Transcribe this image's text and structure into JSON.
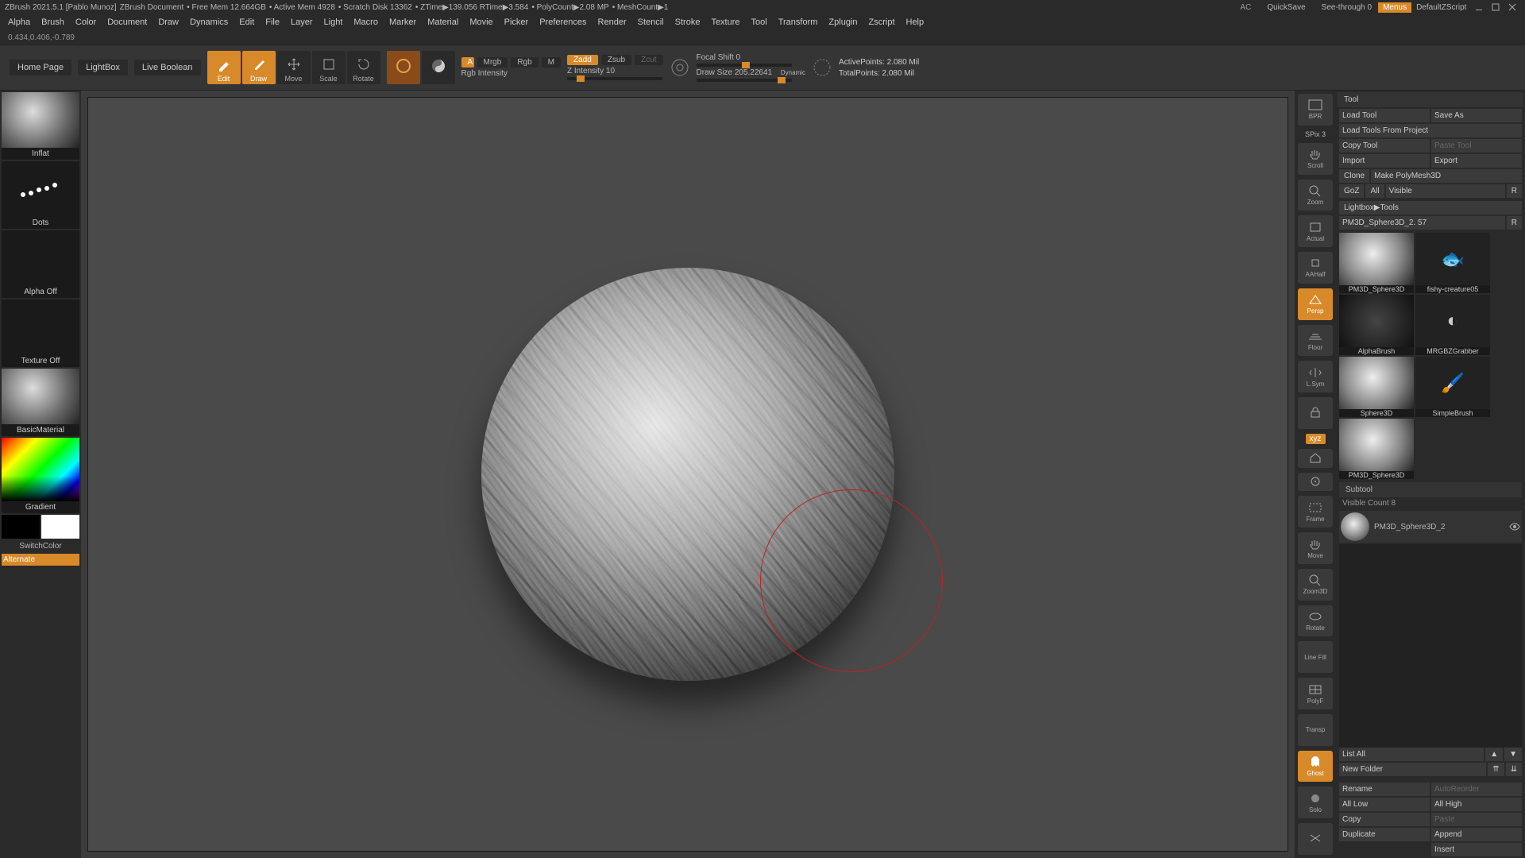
{
  "titlebar": {
    "app": "ZBrush 2021.5.1 [Pablo Munoz]",
    "doc": "ZBrush Document",
    "metrics": [
      "• Free Mem 12.664GB",
      "• Active Mem 4928",
      "• Scratch Disk 13362",
      "• ZTime▶139.056 RTime▶3.584",
      "• PolyCount▶2.08 MP",
      "• MeshCount▶1"
    ],
    "ac": "AC",
    "quicksave": "QuickSave",
    "seethrough": "See-through  0",
    "menus": "Menus",
    "zscript": "DefaultZScript"
  },
  "menu": [
    "Alpha",
    "Brush",
    "Color",
    "Document",
    "Draw",
    "Dynamics",
    "Edit",
    "File",
    "Layer",
    "Light",
    "Macro",
    "Marker",
    "Material",
    "Movie",
    "Picker",
    "Preferences",
    "Render",
    "Stencil",
    "Stroke",
    "Texture",
    "Tool",
    "Transform",
    "Zplugin",
    "Zscript",
    "Help"
  ],
  "coords": "0.434,0.406,-0.789",
  "toolbar": {
    "home": "Home Page",
    "lightbox": "LightBox",
    "liveboolean": "Live Boolean",
    "edit": "Edit",
    "draw": "Draw",
    "move": "Move",
    "scale": "Scale",
    "rotate": "Rotate",
    "a": "A",
    "mrgb": "Mrgb",
    "rgb": "Rgb",
    "m": "M",
    "rgb_intensity": "Rgb Intensity",
    "zadd": "Zadd",
    "zsub": "Zsub",
    "zcut": "Zcut",
    "zintensity": "Z Intensity 10",
    "focal": "Focal Shift 0",
    "drawsize": "Draw Size 205.22641",
    "dynamic": "Dynamic",
    "active": "ActivePoints: 2.080 Mil",
    "total": "TotalPoints: 2.080 Mil"
  },
  "left": {
    "brush": "Inflat",
    "stroke": "Dots",
    "alpha": "Alpha Off",
    "texture": "Texture Off",
    "material": "BasicMaterial",
    "gradient": "Gradient",
    "switch": "SwitchColor",
    "alternate": "Alternate"
  },
  "rightstrip": {
    "bpr": "BPR",
    "spix": "SPix 3",
    "scroll": "Scroll",
    "zoom": "Zoom",
    "actual": "Actual",
    "aahalf": "AAHalf",
    "persp": "Persp",
    "floor": "Floor",
    "lsym": "L.Sym",
    "lock": "",
    "xyz": "xyz",
    "frame": "Frame",
    "move": "Move",
    "zoom3d": "Zoom3D",
    "rotate": "Rotate",
    "linefill": "Line Fill",
    "polyf": "PolyF",
    "transp": "Transp",
    "ghost": "Ghost",
    "solo": "Solo",
    "xpolish": ""
  },
  "tool": {
    "title": "Tool",
    "loadtool": "Load Tool",
    "saveas": "Save As",
    "loadproj": "Load Tools From Project",
    "copytool": "Copy Tool",
    "pastetool": "Paste Tool",
    "import": "Import",
    "export": "Export",
    "clone": "Clone",
    "makepoly": "Make PolyMesh3D",
    "goz": "GoZ",
    "all": "All",
    "visible": "Visible",
    "r": "R",
    "lightbox": "Lightbox▶Tools",
    "current": "PM3D_Sphere3D_2. 57",
    "r2": "R",
    "thumbs": [
      {
        "n": "PM3D_Sphere3D",
        "c": "sphere",
        "x": "8"
      },
      {
        "n": "fishy-creature05",
        "c": "icon"
      },
      {
        "n": "AlphaBrush",
        "c": "alpha"
      },
      {
        "n": "MRGBZGrabber",
        "c": "icon"
      },
      {
        "n": "Sphere3D",
        "c": "sphere"
      },
      {
        "n": "SimpleBrush",
        "c": "icon"
      },
      {
        "n": "PM3D_Sphere3D",
        "c": "sphere"
      }
    ],
    "subtool": "Subtool",
    "viscount": "Visible Count 8",
    "subitem": "PM3D_Sphere3D_2",
    "listall": "List All",
    "newfolder": "New Folder",
    "rename": "Rename",
    "autoreorder": "AutoReorder",
    "alllow": "All Low",
    "allhigh": "All High",
    "copy": "Copy",
    "paste": "Paste",
    "duplicate": "Duplicate",
    "append": "Append",
    "insert": "Insert"
  }
}
